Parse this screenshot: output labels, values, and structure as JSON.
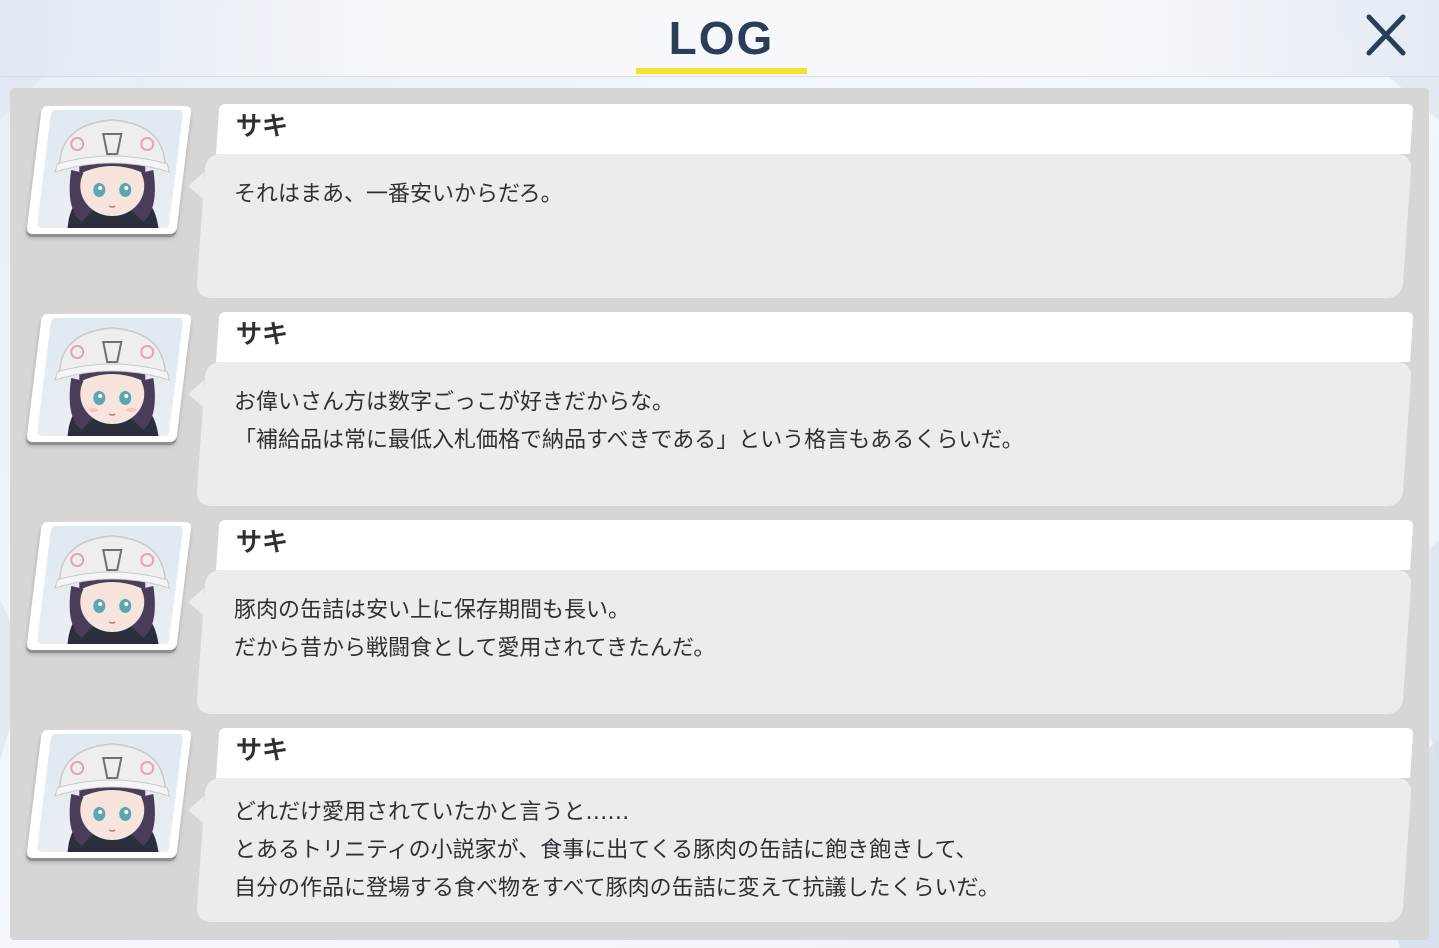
{
  "header": {
    "title": "LOG",
    "title_underline_color": "#f3e12a",
    "close_icon": "close-icon"
  },
  "log": {
    "entries": [
      {
        "speaker": "サキ",
        "portrait_icon": "character-portrait",
        "lines": [
          "それはまあ、一番安いからだろ。"
        ]
      },
      {
        "speaker": "サキ",
        "portrait_icon": "character-portrait",
        "lines": [
          "お偉いさん方は数字ごっこが好きだからな。",
          "「補給品は常に最低入札価格で納品すべきである」という格言もあるくらいだ。"
        ]
      },
      {
        "speaker": "サキ",
        "portrait_icon": "character-portrait",
        "lines": [
          "豚肉の缶詰は安い上に保存期間も長い。",
          "だから昔から戦闘食として愛用されてきたんだ。"
        ]
      },
      {
        "speaker": "サキ",
        "portrait_icon": "character-portrait",
        "lines": [
          "どれだけ愛用されていたかと言うと……",
          "とあるトリニティの小説家が、食事に出てくる豚肉の缶詰に飽き飽きして、",
          "自分の作品に登場する食べ物をすべて豚肉の缶詰に変えて抗議したくらいだ。"
        ]
      }
    ]
  },
  "colors": {
    "title": "#2b3e59",
    "panel": "#d6d6d6",
    "bubble": "#ececed",
    "name_bar": "#ffffff",
    "text": "#2f3036"
  }
}
